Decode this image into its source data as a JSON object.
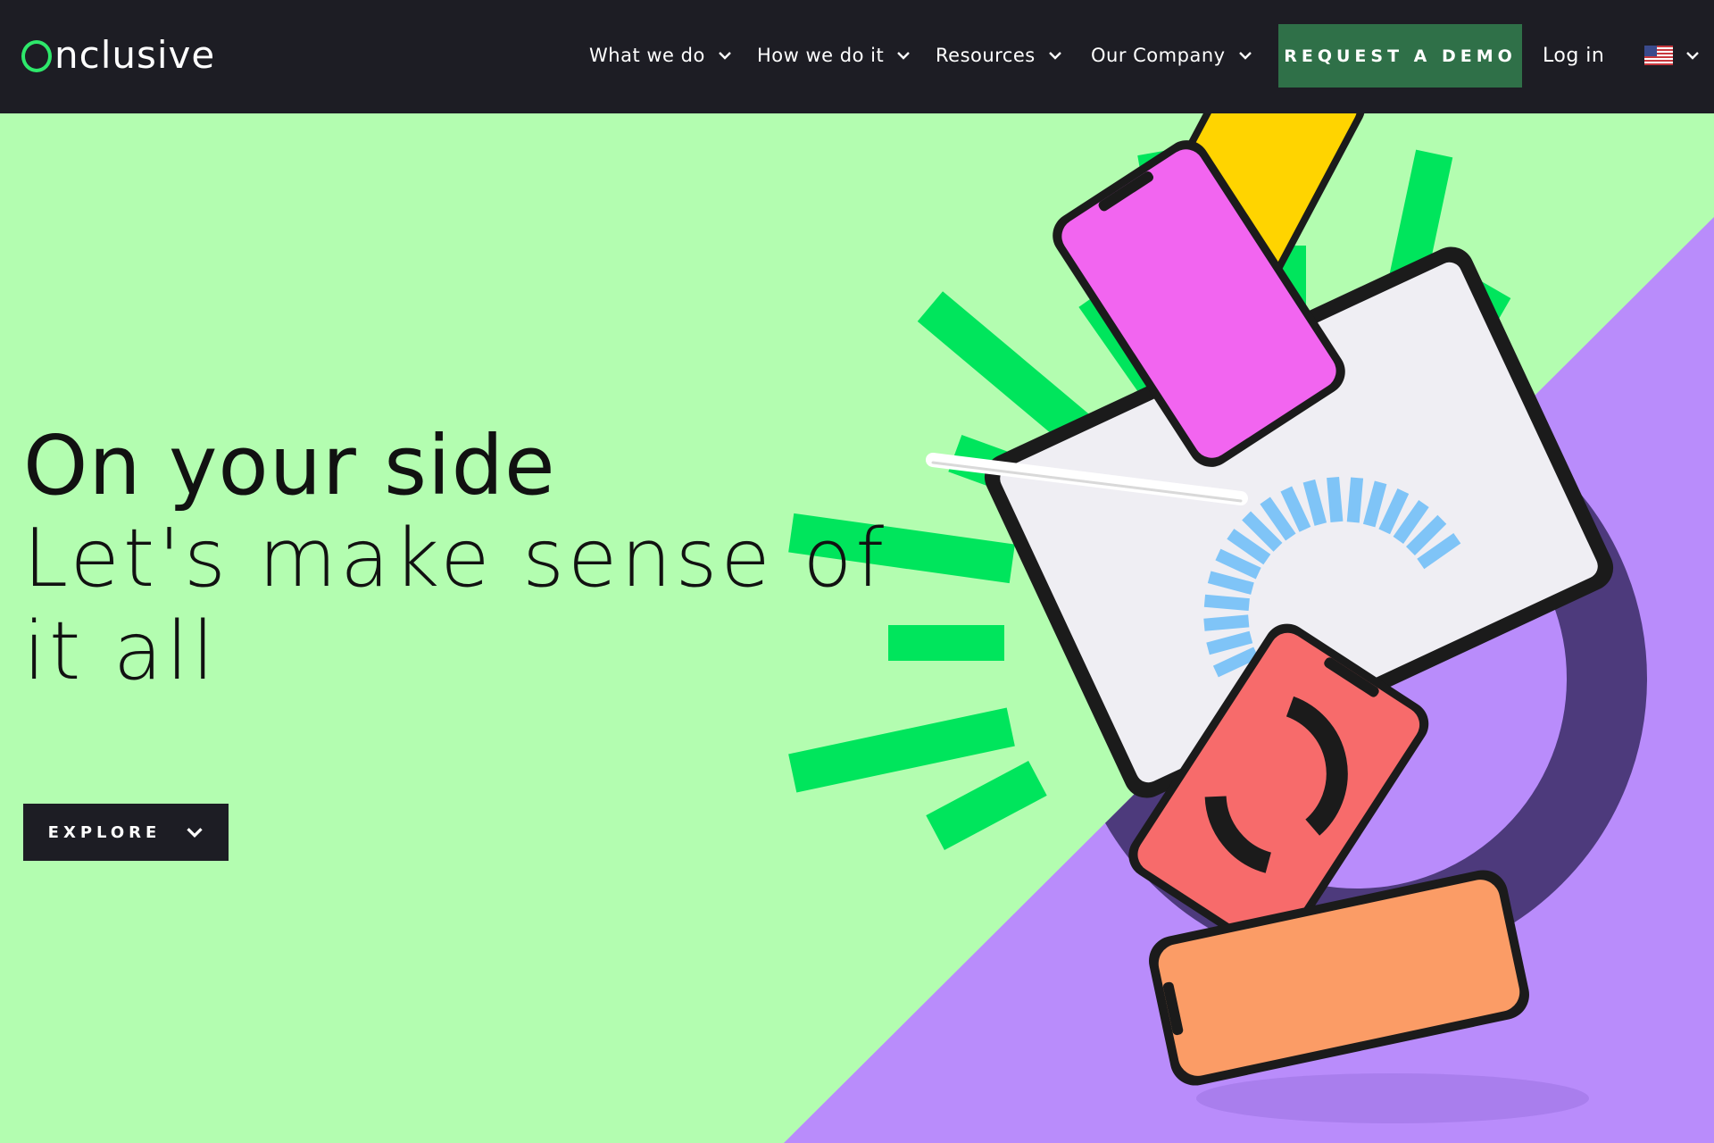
{
  "brand": {
    "name": "Onclusive",
    "logo_rest": "nclusive",
    "accent_color": "#2ee86b"
  },
  "nav": {
    "items": [
      {
        "label": "What we do"
      },
      {
        "label": "How we do it"
      },
      {
        "label": "Resources"
      },
      {
        "label": "Our Company"
      }
    ],
    "cta_label": "REQUEST A DEMO",
    "login_label": "Log in",
    "locale_icon": "us-flag-icon"
  },
  "hero": {
    "headline": "On your side",
    "subheadline": "Let's make sense of it all",
    "explore_label": "EXPLORE"
  },
  "colors": {
    "header_bg": "#1d1d24",
    "hero_bg": "#b3fdb0",
    "cta_bg": "#2f7048",
    "purple": "#b98cfb",
    "dark_purple": "#4d3a7c",
    "burst_green": "#00e55c"
  }
}
